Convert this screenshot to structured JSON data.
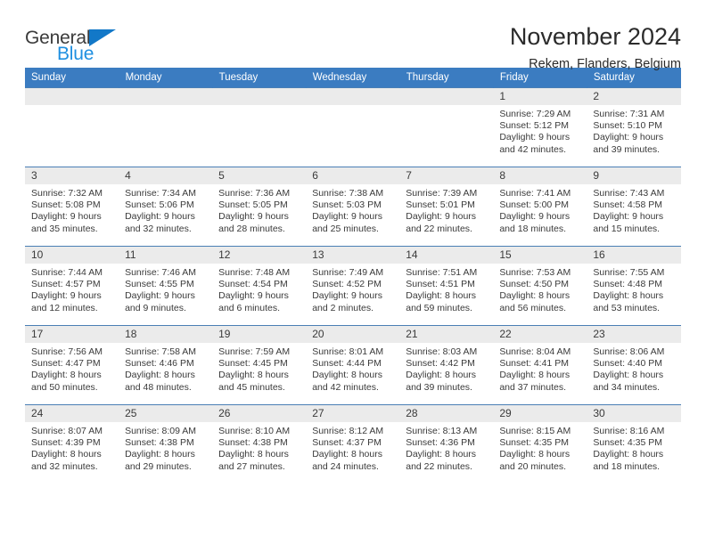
{
  "brand": {
    "name_part1": "General",
    "name_part2": "Blue",
    "triangle_color": "#1278c8",
    "blue_text_color": "#1e8fe0"
  },
  "header": {
    "title": "November 2024",
    "subtitle": "Rekem, Flanders, Belgium",
    "accent_color": "#3b7cc1"
  },
  "weekday_headers": [
    "Sunday",
    "Monday",
    "Tuesday",
    "Wednesday",
    "Thursday",
    "Friday",
    "Saturday"
  ],
  "weeks": [
    [
      {
        "day": "",
        "info": ""
      },
      {
        "day": "",
        "info": ""
      },
      {
        "day": "",
        "info": ""
      },
      {
        "day": "",
        "info": ""
      },
      {
        "day": "",
        "info": ""
      },
      {
        "day": "1",
        "info": "Sunrise: 7:29 AM\nSunset: 5:12 PM\nDaylight: 9 hours\nand 42 minutes."
      },
      {
        "day": "2",
        "info": "Sunrise: 7:31 AM\nSunset: 5:10 PM\nDaylight: 9 hours\nand 39 minutes."
      }
    ],
    [
      {
        "day": "3",
        "info": "Sunrise: 7:32 AM\nSunset: 5:08 PM\nDaylight: 9 hours\nand 35 minutes."
      },
      {
        "day": "4",
        "info": "Sunrise: 7:34 AM\nSunset: 5:06 PM\nDaylight: 9 hours\nand 32 minutes."
      },
      {
        "day": "5",
        "info": "Sunrise: 7:36 AM\nSunset: 5:05 PM\nDaylight: 9 hours\nand 28 minutes."
      },
      {
        "day": "6",
        "info": "Sunrise: 7:38 AM\nSunset: 5:03 PM\nDaylight: 9 hours\nand 25 minutes."
      },
      {
        "day": "7",
        "info": "Sunrise: 7:39 AM\nSunset: 5:01 PM\nDaylight: 9 hours\nand 22 minutes."
      },
      {
        "day": "8",
        "info": "Sunrise: 7:41 AM\nSunset: 5:00 PM\nDaylight: 9 hours\nand 18 minutes."
      },
      {
        "day": "9",
        "info": "Sunrise: 7:43 AM\nSunset: 4:58 PM\nDaylight: 9 hours\nand 15 minutes."
      }
    ],
    [
      {
        "day": "10",
        "info": "Sunrise: 7:44 AM\nSunset: 4:57 PM\nDaylight: 9 hours\nand 12 minutes."
      },
      {
        "day": "11",
        "info": "Sunrise: 7:46 AM\nSunset: 4:55 PM\nDaylight: 9 hours\nand 9 minutes."
      },
      {
        "day": "12",
        "info": "Sunrise: 7:48 AM\nSunset: 4:54 PM\nDaylight: 9 hours\nand 6 minutes."
      },
      {
        "day": "13",
        "info": "Sunrise: 7:49 AM\nSunset: 4:52 PM\nDaylight: 9 hours\nand 2 minutes."
      },
      {
        "day": "14",
        "info": "Sunrise: 7:51 AM\nSunset: 4:51 PM\nDaylight: 8 hours\nand 59 minutes."
      },
      {
        "day": "15",
        "info": "Sunrise: 7:53 AM\nSunset: 4:50 PM\nDaylight: 8 hours\nand 56 minutes."
      },
      {
        "day": "16",
        "info": "Sunrise: 7:55 AM\nSunset: 4:48 PM\nDaylight: 8 hours\nand 53 minutes."
      }
    ],
    [
      {
        "day": "17",
        "info": "Sunrise: 7:56 AM\nSunset: 4:47 PM\nDaylight: 8 hours\nand 50 minutes."
      },
      {
        "day": "18",
        "info": "Sunrise: 7:58 AM\nSunset: 4:46 PM\nDaylight: 8 hours\nand 48 minutes."
      },
      {
        "day": "19",
        "info": "Sunrise: 7:59 AM\nSunset: 4:45 PM\nDaylight: 8 hours\nand 45 minutes."
      },
      {
        "day": "20",
        "info": "Sunrise: 8:01 AM\nSunset: 4:44 PM\nDaylight: 8 hours\nand 42 minutes."
      },
      {
        "day": "21",
        "info": "Sunrise: 8:03 AM\nSunset: 4:42 PM\nDaylight: 8 hours\nand 39 minutes."
      },
      {
        "day": "22",
        "info": "Sunrise: 8:04 AM\nSunset: 4:41 PM\nDaylight: 8 hours\nand 37 minutes."
      },
      {
        "day": "23",
        "info": "Sunrise: 8:06 AM\nSunset: 4:40 PM\nDaylight: 8 hours\nand 34 minutes."
      }
    ],
    [
      {
        "day": "24",
        "info": "Sunrise: 8:07 AM\nSunset: 4:39 PM\nDaylight: 8 hours\nand 32 minutes."
      },
      {
        "day": "25",
        "info": "Sunrise: 8:09 AM\nSunset: 4:38 PM\nDaylight: 8 hours\nand 29 minutes."
      },
      {
        "day": "26",
        "info": "Sunrise: 8:10 AM\nSunset: 4:38 PM\nDaylight: 8 hours\nand 27 minutes."
      },
      {
        "day": "27",
        "info": "Sunrise: 8:12 AM\nSunset: 4:37 PM\nDaylight: 8 hours\nand 24 minutes."
      },
      {
        "day": "28",
        "info": "Sunrise: 8:13 AM\nSunset: 4:36 PM\nDaylight: 8 hours\nand 22 minutes."
      },
      {
        "day": "29",
        "info": "Sunrise: 8:15 AM\nSunset: 4:35 PM\nDaylight: 8 hours\nand 20 minutes."
      },
      {
        "day": "30",
        "info": "Sunrise: 8:16 AM\nSunset: 4:35 PM\nDaylight: 8 hours\nand 18 minutes."
      }
    ]
  ]
}
